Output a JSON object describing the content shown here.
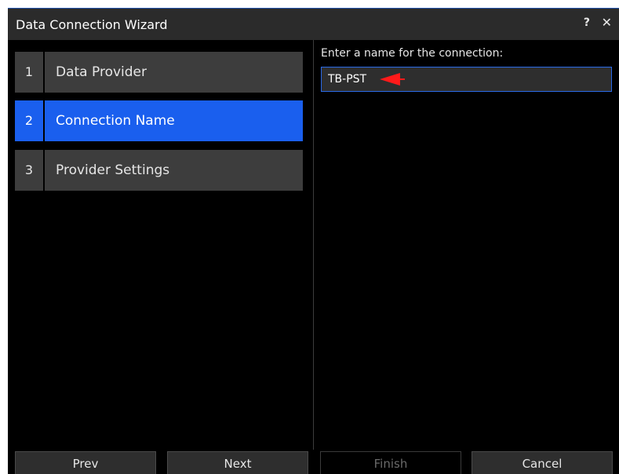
{
  "window": {
    "title": "Data Connection Wizard",
    "help_icon": "?",
    "close_icon": "✕"
  },
  "steps": [
    {
      "number": "1",
      "label": "Data Provider",
      "active": false
    },
    {
      "number": "2",
      "label": "Connection Name",
      "active": true
    },
    {
      "number": "3",
      "label": "Provider Settings",
      "active": false
    }
  ],
  "connection": {
    "label": "Enter a name for the connection:",
    "value": "TB-PST"
  },
  "footer": {
    "prev_label": "Prev",
    "next_label": "Next",
    "finish_label": "Finish",
    "cancel_label": "Cancel",
    "finish_enabled": false
  },
  "colors": {
    "active_step": "#1a5fee",
    "inactive_step": "#3d3d3d",
    "annotation_arrow": "#ff1a1a"
  }
}
